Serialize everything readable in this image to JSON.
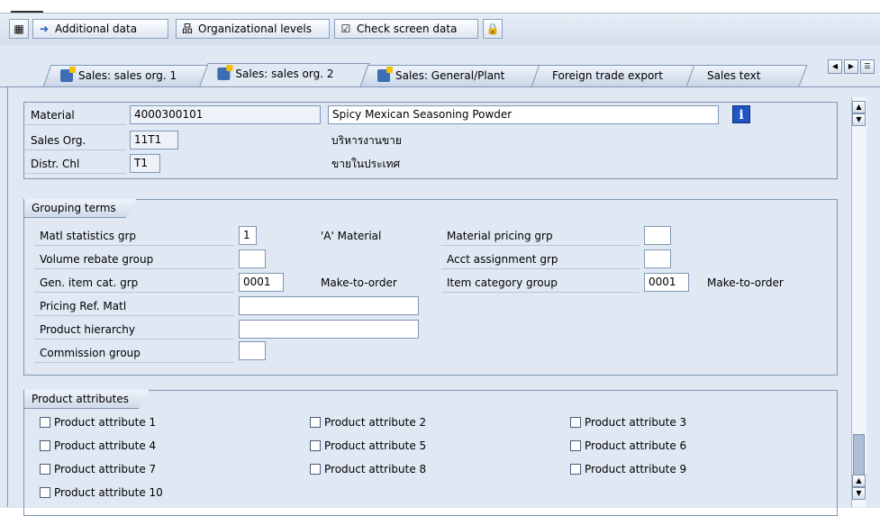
{
  "toolbar": {
    "additional_data": "Additional data",
    "organizational_levels": "Organizational levels",
    "check_screen_data": "Check screen data"
  },
  "tabs": [
    {
      "label": "Sales: sales org. 1"
    },
    {
      "label": "Sales: sales org. 2"
    },
    {
      "label": "Sales: General/Plant"
    },
    {
      "label": "Foreign trade export"
    },
    {
      "label": "Sales text"
    }
  ],
  "header": {
    "material_label": "Material",
    "material_value": "4000300101",
    "material_desc": "Spicy Mexican Seasoning Powder",
    "sales_org_label": "Sales Org.",
    "sales_org_value": "11T1",
    "sales_org_desc": "บริหารงานขาย",
    "distr_chl_label": "Distr. Chl",
    "distr_chl_value": "T1",
    "distr_chl_desc": "ขายในประเทศ"
  },
  "grouping": {
    "title": "Grouping terms",
    "matl_stat_label": "Matl statistics grp",
    "matl_stat_value": "1",
    "matl_stat_desc": "'A' Material",
    "mat_pricing_label": "Material pricing grp",
    "mat_pricing_value": "",
    "vol_rebate_label": "Volume rebate group",
    "vol_rebate_value": "",
    "acct_assign_label": "Acct assignment grp",
    "acct_assign_value": "",
    "gen_item_label": "Gen. item cat. grp",
    "gen_item_value": "0001",
    "gen_item_desc": "Make-to-order",
    "item_cat_label": "Item category group",
    "item_cat_value": "0001",
    "item_cat_desc": "Make-to-order",
    "pricing_ref_label": "Pricing Ref. Matl",
    "pricing_ref_value": "",
    "prod_hier_label": "Product hierarchy",
    "prod_hier_value": "",
    "commission_label": "Commission group",
    "commission_value": ""
  },
  "attributes": {
    "title": "Product attributes",
    "items": [
      "Product attribute 1",
      "Product attribute 2",
      "Product attribute 3",
      "Product attribute 4",
      "Product attribute 5",
      "Product attribute 6",
      "Product attribute 7",
      "Product attribute 8",
      "Product attribute 9",
      "Product attribute 10"
    ]
  },
  "colors": {
    "background": "#dfe8f3",
    "border": "#8196b4",
    "info_button": "#1f55c5"
  },
  "icons": {
    "tab_icon": "sales-view-icon",
    "info": "info-icon",
    "lock": "lock-icon"
  }
}
